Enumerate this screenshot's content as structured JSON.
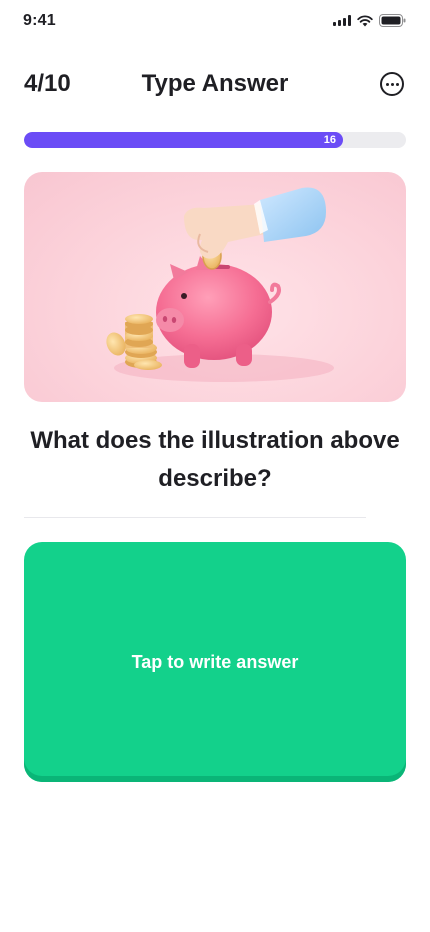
{
  "status_bar": {
    "time": "9:41"
  },
  "header": {
    "counter": "4/10",
    "title": "Type Answer"
  },
  "progress": {
    "value": 16,
    "label": "16",
    "fraction": 0.835,
    "color": "#6b4cf6"
  },
  "question": {
    "text": "What does the illustration above describe?"
  },
  "answer": {
    "label": "Tap to write answer",
    "color": "#13d18b"
  },
  "icons": [
    "signal-icon",
    "wifi-icon",
    "battery-icon",
    "more-options-icon",
    "piggy-bank-illustration"
  ]
}
